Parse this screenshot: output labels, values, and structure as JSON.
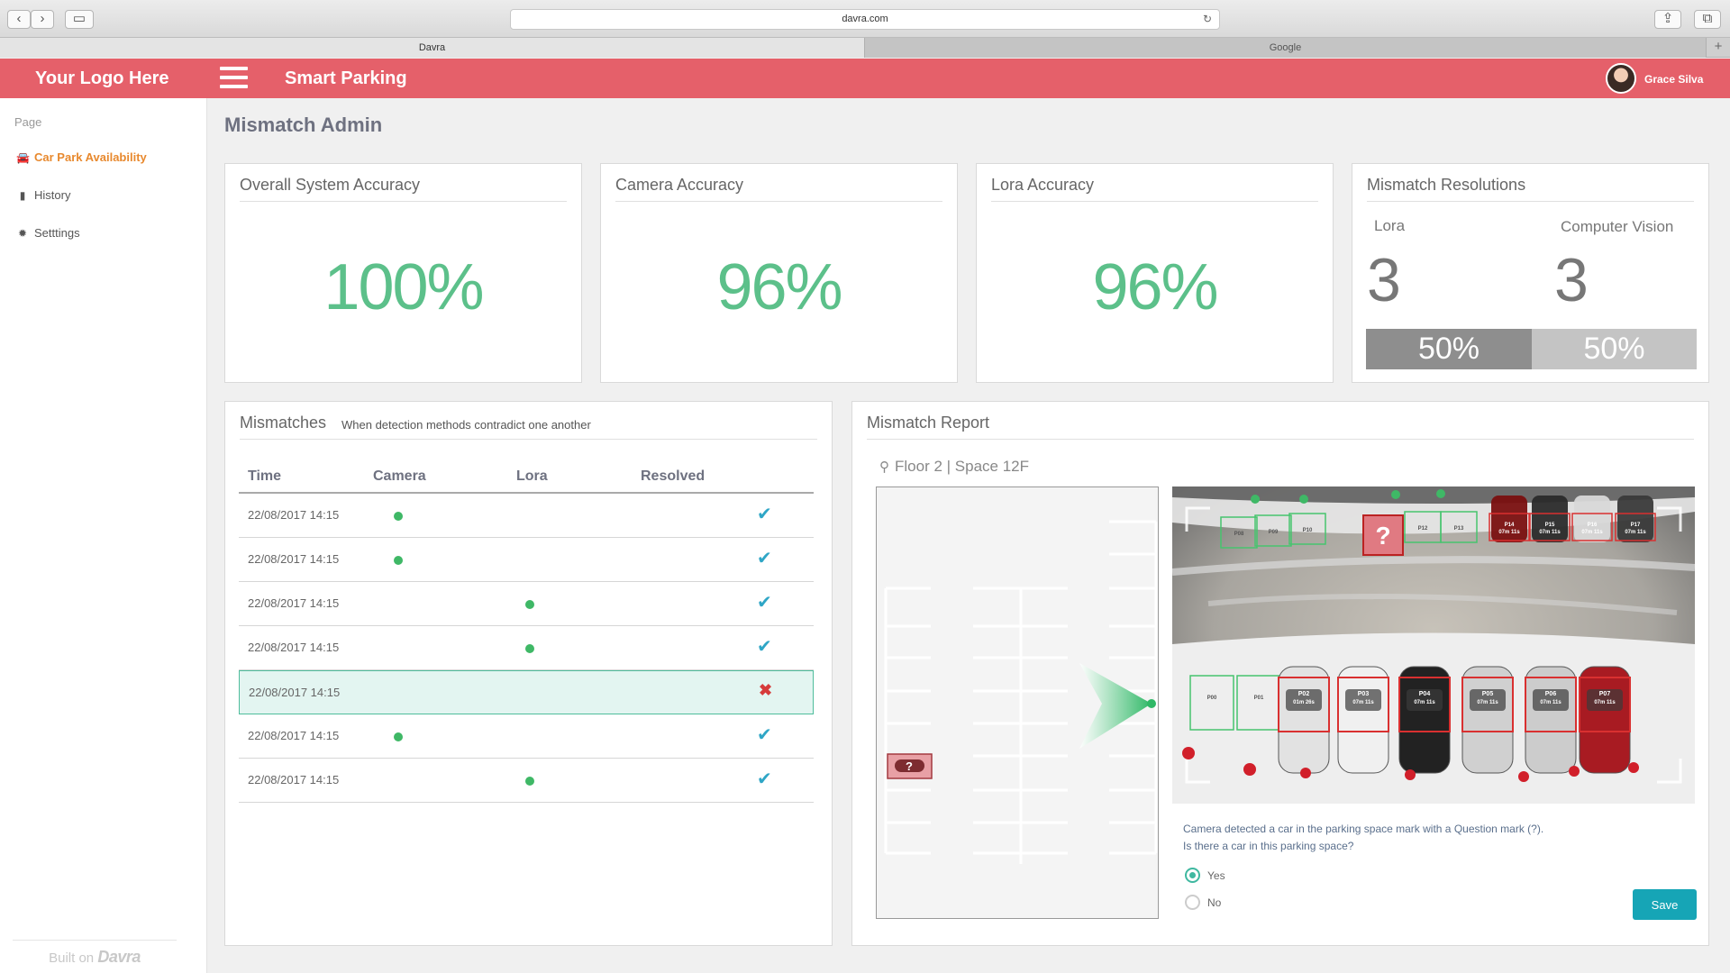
{
  "browser": {
    "url": "davra.com",
    "tabs": [
      {
        "label": "Davra"
      },
      {
        "label": "Google"
      }
    ]
  },
  "header": {
    "logo": "Your Logo Here",
    "app_title": "Smart Parking",
    "user_name": "Grace Silva"
  },
  "sidebar": {
    "section": "Page",
    "items": [
      {
        "label": "Car Park Availability",
        "icon": "car-icon",
        "active": true
      },
      {
        "label": "History",
        "icon": "book-icon",
        "active": false
      },
      {
        "label": "Setttings",
        "icon": "gear-icon",
        "active": false
      }
    ],
    "footer_text": "Built on",
    "footer_brand": "Davra"
  },
  "page_title": "Mismatch Admin",
  "cards": {
    "overall": {
      "title": "Overall System Accuracy",
      "value": "100%"
    },
    "camera": {
      "title": "Camera Accuracy",
      "value": "96%"
    },
    "lora": {
      "title": "Lora Accuracy",
      "value": "96%"
    },
    "resolutions": {
      "title": "Mismatch Resolutions",
      "lora_label": "Lora",
      "lora_count": "3",
      "lora_pct": "50%",
      "cv_label": "Computer Vision",
      "cv_count": "3",
      "cv_pct": "50%"
    }
  },
  "mismatches": {
    "title": "Mismatches",
    "subtitle": "When detection methods contradict one another",
    "columns": [
      "Time",
      "Camera",
      "Lora",
      "Resolved"
    ],
    "rows": [
      {
        "time": "22/08/2017 14:15",
        "camera": true,
        "lora": false,
        "resolved": true,
        "selected": false
      },
      {
        "time": "22/08/2017 14:15",
        "camera": true,
        "lora": false,
        "resolved": true,
        "selected": false
      },
      {
        "time": "22/08/2017 14:15",
        "camera": false,
        "lora": true,
        "resolved": true,
        "selected": false
      },
      {
        "time": "22/08/2017 14:15",
        "camera": false,
        "lora": true,
        "resolved": true,
        "selected": false
      },
      {
        "time": "22/08/2017 14:15",
        "camera": false,
        "lora": false,
        "resolved": false,
        "selected": true
      },
      {
        "time": "22/08/2017 14:15",
        "camera": true,
        "lora": false,
        "resolved": true,
        "selected": false
      },
      {
        "time": "22/08/2017 14:15",
        "camera": false,
        "lora": true,
        "resolved": true,
        "selected": false
      }
    ]
  },
  "report": {
    "title": "Mismatch Report",
    "location": "Floor 2 | Space 12F",
    "question_line1": "Camera detected a car in the parking space mark with a Question mark (?).",
    "question_line2": "Is there a car in this parking space?",
    "options": [
      {
        "label": "Yes",
        "selected": true
      },
      {
        "label": "No",
        "selected": false
      }
    ],
    "save_label": "Save",
    "marker_symbol": "?",
    "space_labels": [
      "P08",
      "P09",
      "P10",
      "P12",
      "P13",
      "P14",
      "P15",
      "P16",
      "P17",
      "P00",
      "P01",
      "P02",
      "P03",
      "P04",
      "P05",
      "P06",
      "P07"
    ],
    "time_labels": [
      "07m 11s",
      "07m 11s",
      "07m 11s",
      "07m 11s",
      "01m 26s",
      "07m 11s",
      "07m 11s",
      "07m 11s",
      "07m 11s",
      "07m 11s"
    ]
  },
  "colors": {
    "header": "#e5606a",
    "accent_green": "#5cc08a",
    "active_nav": "#e8892e",
    "save_button": "#16a5b6",
    "lora_bar": "#8e8e8e",
    "cv_bar": "#c4c4c4"
  }
}
